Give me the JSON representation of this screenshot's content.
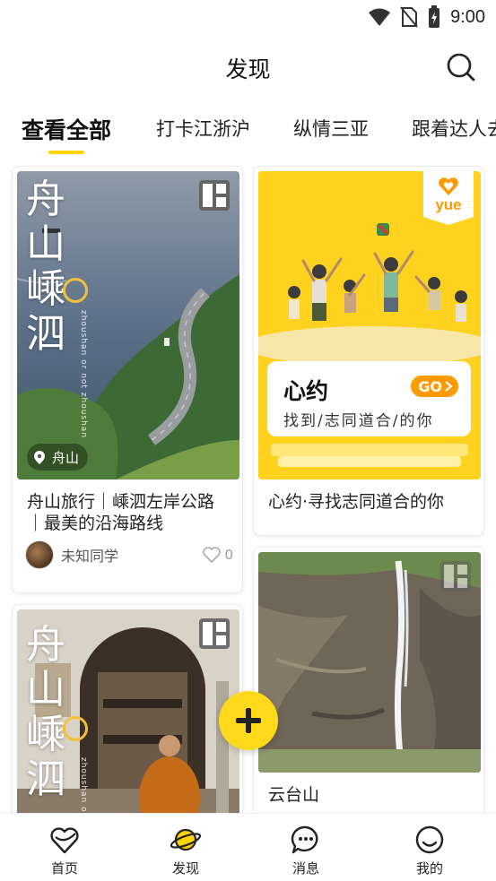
{
  "status_bar": {
    "time": "9:00"
  },
  "header": {
    "title": "发现"
  },
  "tabs": [
    {
      "label": "查看全部",
      "active": true
    },
    {
      "label": "打卡江浙沪"
    },
    {
      "label": "纵情三亚"
    },
    {
      "label": "跟着达人去"
    }
  ],
  "cards": {
    "zhoushan_road": {
      "title": "舟山旅行｜嵊泗左岸公路｜最美的沿海路线",
      "cover_text": [
        "舟",
        "山",
        "嵊",
        "泗"
      ],
      "cover_en": "zhoushan or not zhoushan",
      "location": "舟山",
      "author": "未知同学",
      "likes": "0"
    },
    "xinyue": {
      "title": "心约·寻找志同道合的你",
      "banner_title": "心约",
      "banner_go": "GO",
      "banner_sub": "找到/志同道合/的你",
      "badge": "yue"
    },
    "yuntaishan": {
      "title": "云台山"
    },
    "zhoushan_temple": {
      "cover_text": [
        "舟",
        "山",
        "嵊",
        "泗"
      ],
      "cover_en": "zhoushan or not zhoushan"
    }
  },
  "bottom_nav": [
    {
      "label": "首页",
      "icon": "heart-outline-icon"
    },
    {
      "label": "发现",
      "icon": "planet-icon",
      "active": true
    },
    {
      "label": "消息",
      "icon": "chat-bubble-icon"
    },
    {
      "label": "我的",
      "icon": "smile-face-icon"
    }
  ],
  "colors": {
    "accent": "#ffd400",
    "go_orange": "#ff9a00",
    "xinyue_yellow": "#ffd21f"
  }
}
